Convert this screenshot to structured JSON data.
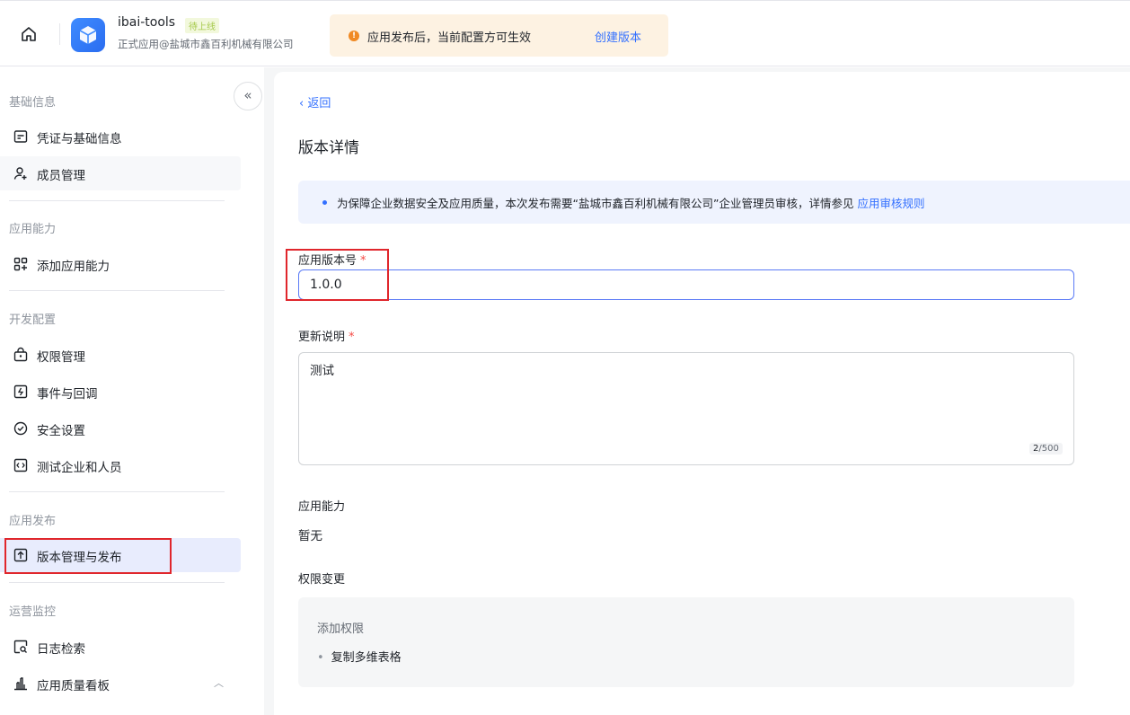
{
  "header": {
    "app_name": "ibai-tools",
    "app_badge": "待上线",
    "app_subtitle": "正式应用@盐城市鑫百利机械有限公司",
    "notice_icon": "!",
    "notice_text": "应用发布后，当前配置方可生效",
    "notice_link": "创建版本"
  },
  "sidebar": {
    "collapse_glyph": "«",
    "sections": {
      "basic": "基础信息",
      "capability": "应用能力",
      "dev": "开发配置",
      "release": "应用发布",
      "ops": "运营监控"
    },
    "items": {
      "credentials": "凭证与基础信息",
      "members": "成员管理",
      "add_capability": "添加应用能力",
      "permissions": "权限管理",
      "events": "事件与回调",
      "security": "安全设置",
      "test_enterprise": "测试企业和人员",
      "version_release": "版本管理与发布",
      "log_search": "日志检索",
      "quality_board": "应用质量看板"
    }
  },
  "main": {
    "back_label": "返回",
    "page_title": "版本详情",
    "info_text": "为保障企业数据安全及应用质量，本次发布需要“盐城市鑫百利机械有限公司”企业管理员审核，详情参见",
    "info_link": "应用审核规则",
    "version_label": "应用版本号",
    "version_value": "1.0.0",
    "required_mark": "*",
    "notes_label": "更新说明",
    "notes_value": "测试",
    "notes_count": "2",
    "notes_max": "/500",
    "capability_label": "应用能力",
    "capability_value": "暂无",
    "perm_change_label": "权限变更",
    "perm_add_title": "添加权限",
    "perm_items": [
      "复制多维表格"
    ]
  }
}
